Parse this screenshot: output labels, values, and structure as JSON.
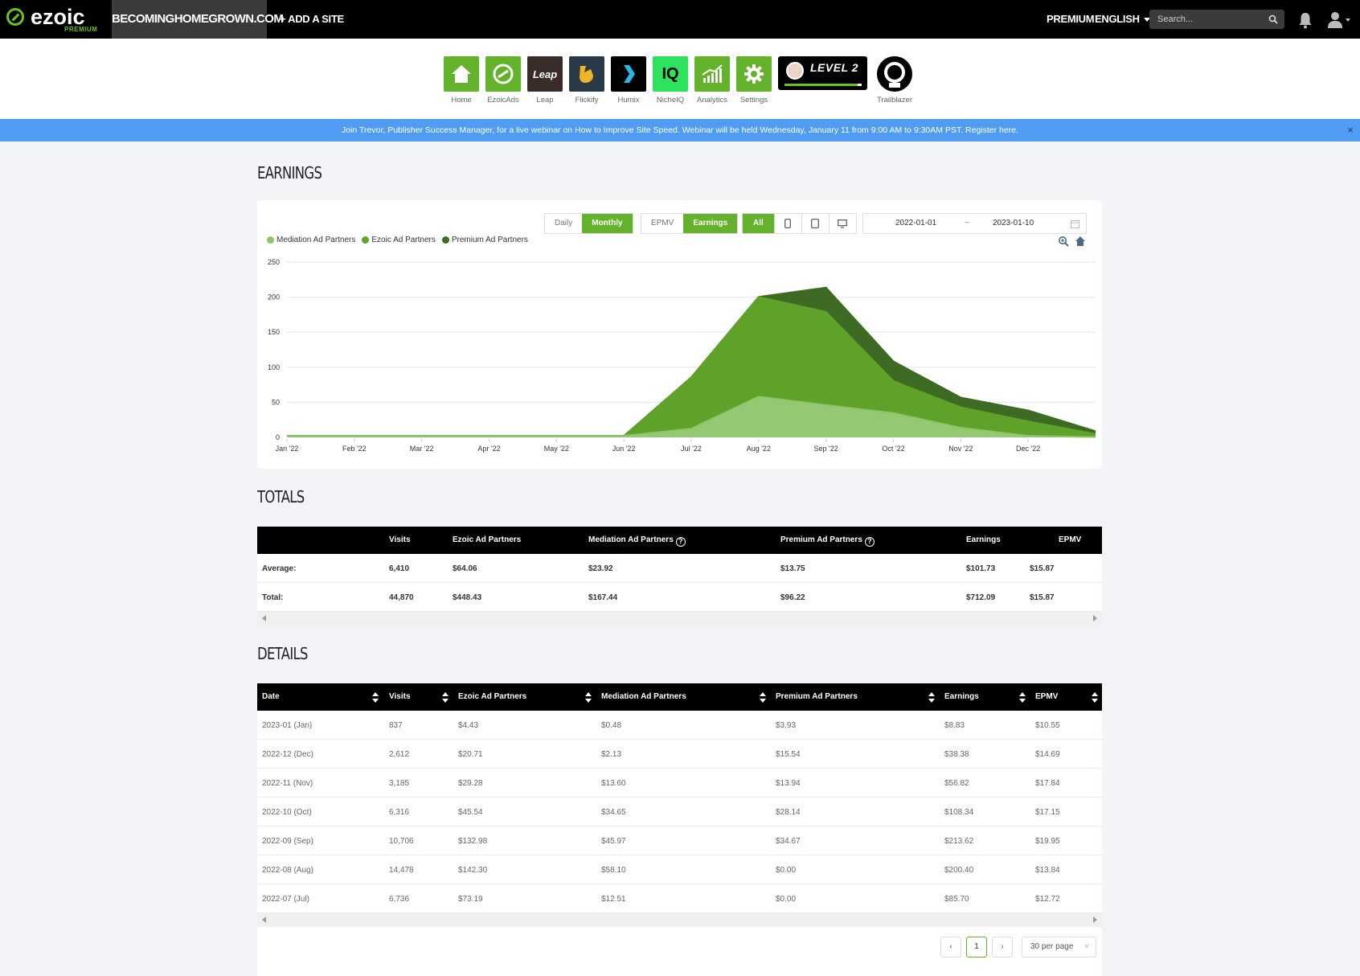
{
  "topbar": {
    "logo": "ezoic",
    "logo_sub": "PREMIUM",
    "site": "BECOMINGHOMEGROWN.COM",
    "add_site": "+ ADD A SITE",
    "premium": "PREMIUM",
    "language": "ENGLISH",
    "search_placeholder": "Search...",
    "icons": [
      "search-icon",
      "bell-icon",
      "user-icon"
    ]
  },
  "apps": [
    {
      "label": "Home",
      "icon": "home-icon"
    },
    {
      "label": "EzoicAds",
      "icon": "ezoicads-icon"
    },
    {
      "label": "Leap",
      "icon": "leap-icon",
      "tile_text": "Leap"
    },
    {
      "label": "Flickify",
      "icon": "flickify-icon"
    },
    {
      "label": "Humix",
      "icon": "humix-icon"
    },
    {
      "label": "NicheIQ",
      "icon": "nicheiq-icon",
      "tile_text": "IQ"
    },
    {
      "label": "Analytics",
      "icon": "analytics-icon"
    },
    {
      "label": "Settings",
      "icon": "settings-icon"
    }
  ],
  "level_badge": {
    "text": "LEVEL 2",
    "progress": 0.95
  },
  "trailblazer": {
    "label": "Trailblazer"
  },
  "banner": {
    "text": "Join Trevor, Publisher Success Manager, for a live webinar on How to Improve Site Speed. Webinar will be held Wednesday, January 11 from 9:00 AM to 9:30AM PST.",
    "link": "Register here.",
    "close": "×"
  },
  "earnings": {
    "title": "EARNINGS",
    "period_buttons": [
      "Daily",
      "Monthly"
    ],
    "period_active": "Monthly",
    "metric_buttons": [
      "EPMV",
      "Earnings"
    ],
    "metric_active": "Earnings",
    "device_all": "All",
    "device_icons": [
      "phone-icon",
      "tablet-icon",
      "desktop-icon"
    ],
    "date_start": "2022-01-01",
    "date_sep": "~",
    "date_end": "2023-01-10",
    "colors": {
      "mediation": "#8fc56a",
      "ezoic": "#5ea22a",
      "premium": "#3e6b23",
      "accent": "#64b22b"
    }
  },
  "chart_data": {
    "type": "area",
    "stacked": true,
    "categories": [
      "Jan '22",
      "Feb '22",
      "Mar '22",
      "Apr '22",
      "May '22",
      "Jun '22",
      "Jul '22",
      "Aug '22",
      "Sep '22",
      "Oct '22",
      "Nov '22",
      "Dec '22",
      "Jan '23"
    ],
    "tick_labels": [
      "Jan '22",
      "Feb '22",
      "Mar '22",
      "Apr '22",
      "May '22",
      "Jun '22",
      "Jul '22",
      "Aug '22",
      "Sep '22",
      "Oct '22",
      "Nov '22",
      "Dec '22"
    ],
    "series": [
      {
        "name": "Mediation Ad Partners",
        "color": "#8fc56a",
        "values": [
          2,
          2,
          2,
          2,
          2,
          2,
          12.51,
          58.1,
          45.97,
          34.65,
          13.6,
          2.13,
          0.48
        ]
      },
      {
        "name": "Ezoic Ad Partners",
        "color": "#5ea22a",
        "values": [
          0,
          0,
          0,
          0,
          0,
          0,
          73.19,
          142.3,
          132.98,
          45.54,
          29.28,
          20.71,
          4.43
        ]
      },
      {
        "name": "Premium Ad Partners",
        "color": "#3e6b23",
        "values": [
          0,
          0,
          0,
          0,
          0,
          0,
          0,
          0,
          34.67,
          28.14,
          13.94,
          15.54,
          3.93
        ]
      }
    ],
    "ylim": [
      0,
      250
    ],
    "yticks": [
      0,
      50,
      100,
      150,
      200,
      250
    ],
    "grid": true,
    "legend_position": "top-left"
  },
  "totals": {
    "title": "TOTALS",
    "columns": [
      "",
      "Visits",
      "Ezoic Ad Partners",
      "Mediation Ad Partners",
      "Premium Ad Partners",
      "Earnings",
      "EPMV"
    ],
    "rows": [
      [
        "Average:",
        "6,410",
        "$64.06",
        "$23.92",
        "$13.75",
        "$101.73",
        "$15.87"
      ],
      [
        "Total:",
        "44,870",
        "$448.43",
        "$167.44",
        "$96.22",
        "$712.09",
        "$15.87"
      ]
    ]
  },
  "details": {
    "title": "DETAILS",
    "columns": [
      "Date",
      "Visits",
      "Ezoic Ad Partners",
      "Mediation Ad Partners",
      "Premium Ad Partners",
      "Earnings",
      "EPMV"
    ],
    "rows": [
      [
        "2023-01 (Jan)",
        "837",
        "$4.43",
        "$0.48",
        "$3.93",
        "$8.83",
        "$10.55"
      ],
      [
        "2022-12 (Dec)",
        "2,612",
        "$20.71",
        "$2.13",
        "$15.54",
        "$38.38",
        "$14.69"
      ],
      [
        "2022-11 (Nov)",
        "3,185",
        "$29.28",
        "$13.60",
        "$13.94",
        "$56.82",
        "$17.84"
      ],
      [
        "2022-10 (Oct)",
        "6,316",
        "$45.54",
        "$34.65",
        "$28.14",
        "$108.34",
        "$17.15"
      ],
      [
        "2022-09 (Sep)",
        "10,706",
        "$132.98",
        "$45.97",
        "$34.67",
        "$213.62",
        "$19.95"
      ],
      [
        "2022-08 (Aug)",
        "14,478",
        "$142.30",
        "$58.10",
        "$0.00",
        "$200.40",
        "$13.84"
      ],
      [
        "2022-07 (Jul)",
        "6,736",
        "$73.19",
        "$12.51",
        "$0.00",
        "$85.70",
        "$12.72"
      ]
    ],
    "pagination": {
      "prev": "‹",
      "page": "1",
      "next": "›",
      "per_page": "30 per page"
    }
  }
}
